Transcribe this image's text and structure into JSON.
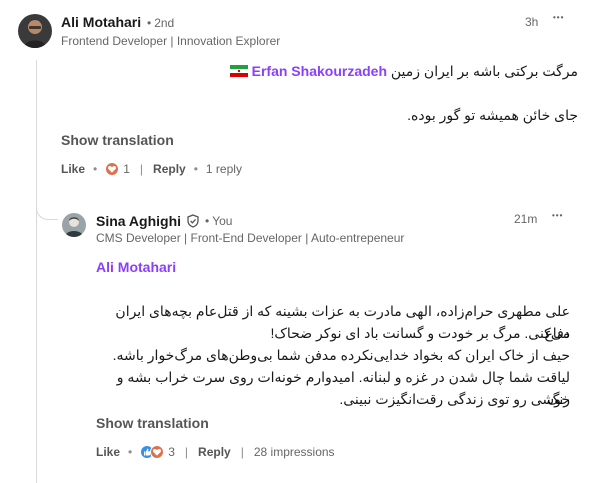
{
  "comment": {
    "author": "Ali Motahari",
    "degree": "2nd",
    "headline": "Frontend Developer | Innovation Explorer",
    "time": "3h",
    "more": "•••",
    "mention": "Erfan Shakourzadeh",
    "line1_text": "مرگت برکتی باشه بر ایران زمین",
    "line2_text": "جای خائن همیشه تو گور بوده.",
    "show_translation": "Show translation",
    "like_label": "Like",
    "reaction_count": "1",
    "reply_label": "Reply",
    "reply_count": "1 reply"
  },
  "reply": {
    "author": "Sina Aghighi",
    "you_label": "You",
    "headline": "CMS Developer | Front-End Developer | Auto-entrepeneur",
    "time": "21m",
    "more": "•••",
    "mention": "Ali Motahari",
    "body_lines": [
      "علی مطهری حرام‌زاده، الهی مادرت به عزات بشینه که از قتل‌عام بچه‌های ایران دفاع",
      "می‌کنی. مرگ بر خودت و گسانت باد ای نوکر ضحاک!",
      "حیف از خاک ایران که بخواد خدایی‌نکرده مدفن شما بی‌وطن‌های مرگ‌خوار باشه.",
      "لیاقت شما چال شدن در غزه و لبنانه. امیدوارم خونه‌ات روی سرت خراب بشه و رنگ",
      "خوشی رو توی زندگی رقت‌انگیزت نبینی."
    ],
    "show_translation": "Show translation",
    "like_label": "Like",
    "reaction_count": "3",
    "reply_label": "Reply",
    "impressions": "28 impressions"
  },
  "colors": {
    "mention": "#8a3ffc",
    "love_reaction": "#df704d",
    "like_reaction": "#378fe9",
    "muted_text": "#666666"
  },
  "icons": {
    "flag": "iran-flag-icon",
    "verified": "verified-shield-icon",
    "love": "heart-reaction-icon",
    "like": "thumbs-up-reaction-icon",
    "more": "ellipsis-icon"
  }
}
